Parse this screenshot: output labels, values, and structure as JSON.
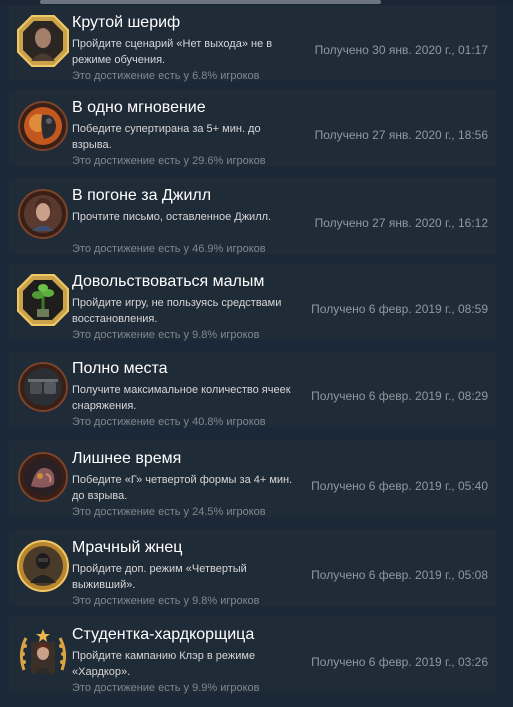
{
  "achievements": [
    {
      "title": "Крутой шериф",
      "desc": "Пройдите сценарий «Нет выхода» не в режиме обучения.",
      "unlocked": "Получено 30 янв. 2020 г., 01:17",
      "percent": "Это достижение есть у 6.8% игроков",
      "frame": "gold",
      "icon": "sheriff-portrait-icon"
    },
    {
      "title": "В одно мгновение",
      "desc": "Победите супертирана за 5+ мин. до взрыва.",
      "unlocked": "Получено 27 янв. 2020 г., 18:56",
      "percent": "Это достижение есть у 29.6% игроков",
      "frame": "bronze",
      "icon": "tyrant-punch-icon"
    },
    {
      "title": "В погоне за Джилл",
      "desc": "Прочтите письмо, оставленное Джилл.",
      "unlocked": "Получено 27 янв. 2020 г., 16:12",
      "percent": "Это достижение есть у 46.9% игроков",
      "frame": "bronze",
      "icon": "jill-portrait-icon"
    },
    {
      "title": "Довольствоваться малым",
      "desc": "Пройдите игру, не пользуясь средствами восстановления.",
      "unlocked": "Получено 6 февр. 2019 г., 08:59",
      "percent": "Это достижение есть у 9.8% игроков",
      "frame": "gold",
      "icon": "green-herb-icon"
    },
    {
      "title": "Полно места",
      "desc": "Получите максимальное количество ячеек снаряжения.",
      "unlocked": "Получено 6 февр. 2019 г., 08:29",
      "percent": "Это достижение есть у 40.8% игроков",
      "frame": "bronze",
      "icon": "hip-pouches-icon"
    },
    {
      "title": "Лишнее время",
      "desc": "Победите «Г» четвертой формы за 4+ мин. до взрыва.",
      "unlocked": "Получено 6 февр. 2019 г., 05:40",
      "percent": "Это достижение есть у 24.5% игроков",
      "frame": "bronze",
      "icon": "g-creature-icon"
    },
    {
      "title": "Мрачный жнец",
      "desc": "Пройдите доп. режим «Четвертый выживший».",
      "unlocked": "Получено 6 февр. 2019 г., 05:08",
      "percent": "Это достижение есть у 9.8% игроков",
      "frame": "gold",
      "icon": "hunk-soldier-icon"
    },
    {
      "title": "Студентка-хардкорщица",
      "desc": "Пройдите кампанию Клэр в режиме «Хардкор».",
      "unlocked": "Получено 6 февр. 2019 г., 03:26",
      "percent": "Это достижение есть у 9.9% игроков",
      "frame": "laurel",
      "icon": "claire-portrait-icon"
    }
  ],
  "colors": {
    "background": "#1b2838",
    "row": "#202b38",
    "gold": "#d9a441",
    "bronze": "#6a3b23"
  }
}
